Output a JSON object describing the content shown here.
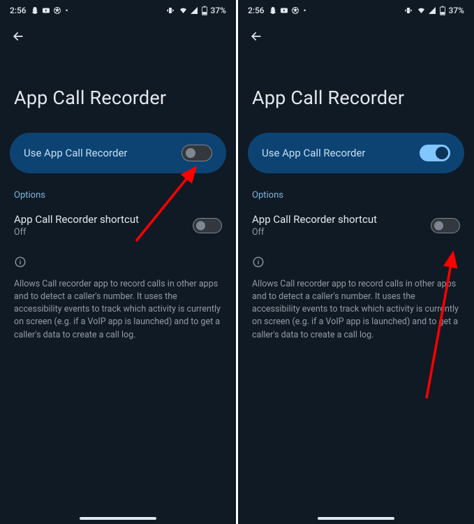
{
  "statusBar": {
    "time": "2:56",
    "battery": "37%"
  },
  "pageTitle": "App Call Recorder",
  "hero": {
    "label": "Use App Call Recorder"
  },
  "options": {
    "sectionLabel": "Options",
    "shortcut": {
      "title": "App Call Recorder shortcut",
      "status": "Off"
    }
  },
  "description": "Allows Call recorder app to record calls in other apps and to detect a caller's number. It uses the accessibility events to track which activity is currently on screen (e.g. if a VoIP app is launched) and to get a caller's data to create a call log."
}
